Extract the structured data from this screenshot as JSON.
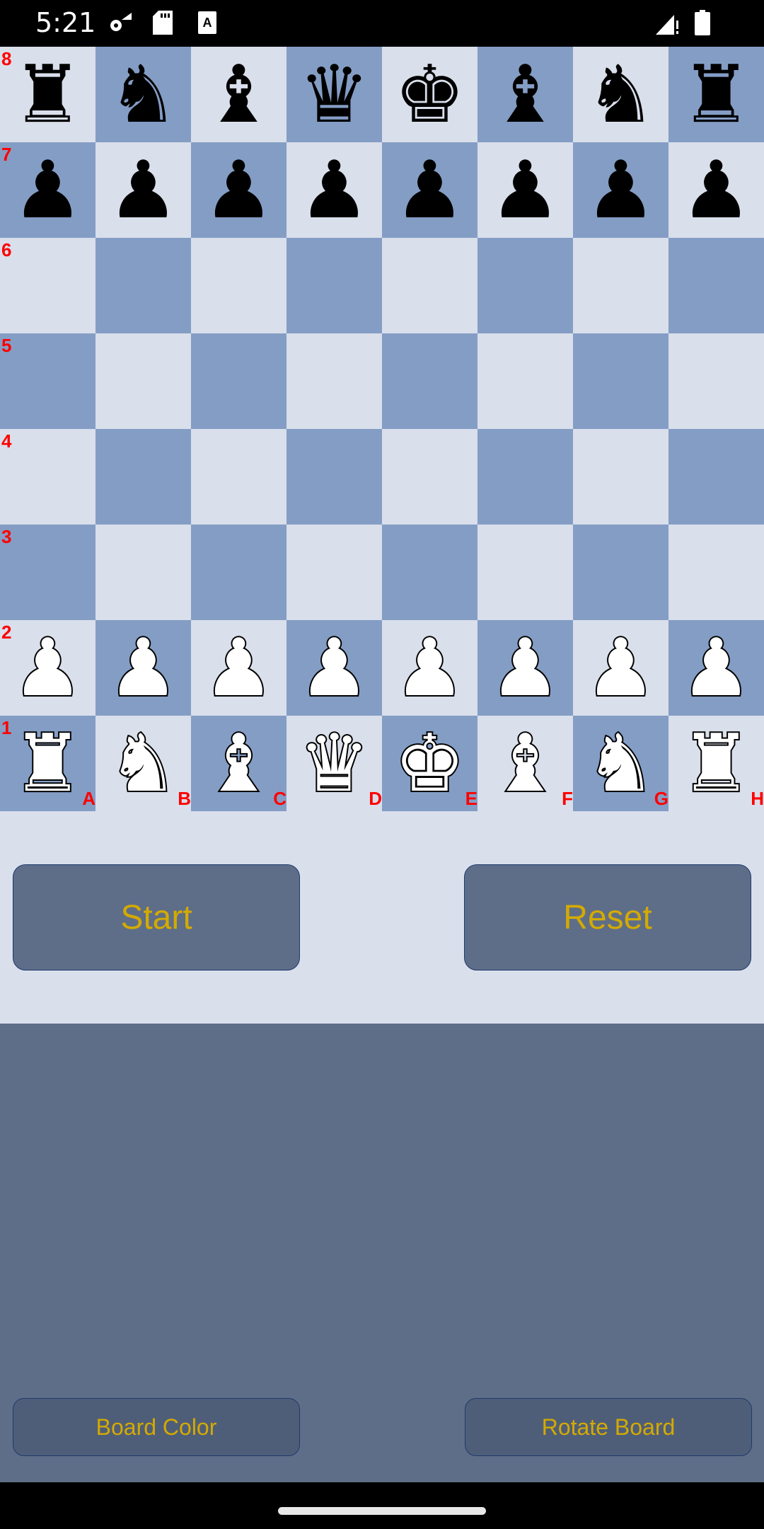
{
  "status_bar": {
    "time": "5:21",
    "left_icons": [
      "settings-icon",
      "sd-card-icon",
      "accessibility-a-icon"
    ],
    "right_icons": [
      "signal-no-internet-icon",
      "battery-icon"
    ]
  },
  "board": {
    "light_color": "#d9dfeb",
    "dark_color": "#849dc5",
    "label_color": "#ff0000",
    "ranks": [
      "8",
      "7",
      "6",
      "5",
      "4",
      "3",
      "2",
      "1"
    ],
    "files": [
      "A",
      "B",
      "C",
      "D",
      "E",
      "F",
      "G",
      "H"
    ],
    "position": [
      [
        "br",
        "bn",
        "bb",
        "bq",
        "bk",
        "bb",
        "bn",
        "br"
      ],
      [
        "bp",
        "bp",
        "bp",
        "bp",
        "bp",
        "bp",
        "bp",
        "bp"
      ],
      [
        "",
        "",
        "",
        "",
        "",
        "",
        "",
        ""
      ],
      [
        "",
        "",
        "",
        "",
        "",
        "",
        "",
        ""
      ],
      [
        "",
        "",
        "",
        "",
        "",
        "",
        "",
        ""
      ],
      [
        "",
        "",
        "",
        "",
        "",
        "",
        "",
        ""
      ],
      [
        "wp",
        "wp",
        "wp",
        "wp",
        "wp",
        "wp",
        "wp",
        "wp"
      ],
      [
        "wr",
        "wn",
        "wb",
        "wq",
        "wk",
        "wb",
        "wn",
        "wr"
      ]
    ]
  },
  "buttons": {
    "start": "Start",
    "reset": "Reset",
    "board_color": "Board Color",
    "rotate_board": "Rotate Board"
  },
  "colors": {
    "button_text": "#d4aa00",
    "button_bg": "#5e6e88",
    "panel_bg": "#5e6e88"
  }
}
